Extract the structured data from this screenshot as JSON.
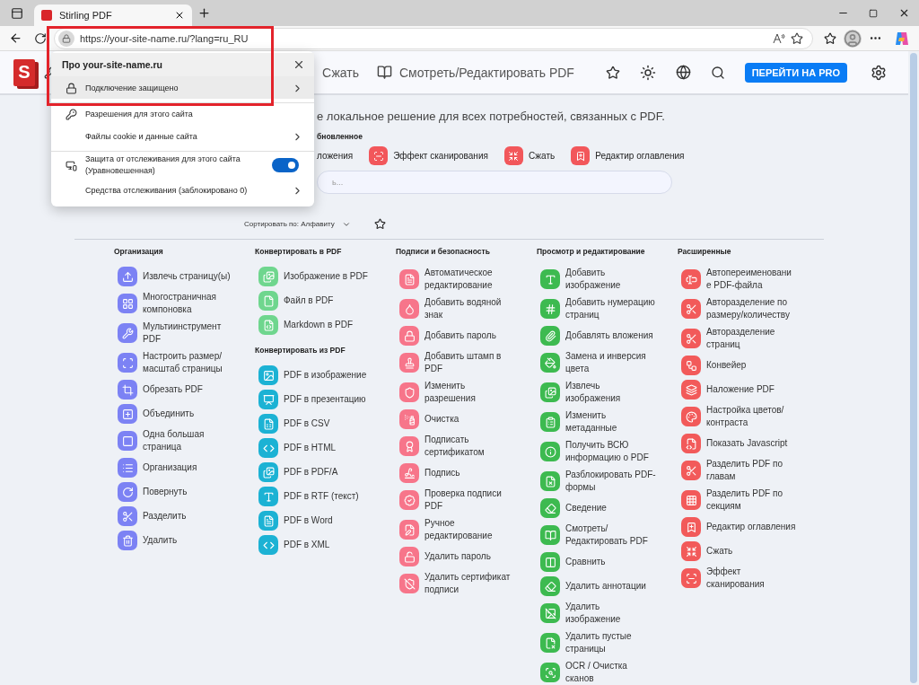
{
  "browser": {
    "tab": {
      "title": "Stirling PDF"
    },
    "address": "https://your-site-name.ru/?lang=ru_RU"
  },
  "site_info_popup": {
    "title": "Про your-site-name.ru",
    "rows": [
      {
        "kind": "link",
        "label": "Подключение защищено",
        "selected": true,
        "divider_before": false
      },
      {
        "kind": "plain",
        "label": "Разрешения для этого сайта",
        "selected": false,
        "divider_before": true
      },
      {
        "kind": "link",
        "label": "Файлы cookie и данные сайта",
        "selected": false,
        "divider_before": false
      },
      {
        "kind": "toggle",
        "label": "Защита от отслеживания для этого сайта (Уравновешенная)",
        "on": true,
        "selected": false,
        "divider_before": true
      },
      {
        "kind": "link",
        "label": "Средства отслеживания (заблокировано 0)",
        "selected": false,
        "divider_before": false
      }
    ]
  },
  "app": {
    "logo": "S",
    "nav": [
      {
        "label": "Сжать"
      },
      {
        "label": "Смотреть/Редактировать PDF"
      }
    ],
    "pro_button": "ПЕРЕЙТИ НА PRO"
  },
  "intro": {
    "tagline": "е локальное решение для всех потребностей, связанных с PDF.",
    "favorites_heading": "бновленное",
    "favorites": [
      {
        "kind": "partial",
        "label": "ложения"
      },
      {
        "kind": "full",
        "label": "Эффект сканирования"
      },
      {
        "kind": "full",
        "label": "Сжать"
      },
      {
        "kind": "full",
        "label": "Редактир оглавления"
      }
    ],
    "search": {
      "placeholder": "ь..."
    }
  },
  "sort": {
    "label": "Сортировать по: Алфавиту"
  },
  "columns": [
    {
      "sections": [
        {
          "title": "Организация",
          "color": "#7c82f4",
          "items": [
            "Извлечь страницу(ы)",
            "Многостраничная компоновка",
            "Мультиинструмент PDF",
            "Настроить размер/ масштаб страницы",
            "Обрезать PDF",
            "Объединить",
            "Одна большая страница",
            "Организация",
            "Повернуть",
            "Разделить",
            "Удалить"
          ]
        }
      ]
    },
    {
      "sections": [
        {
          "title": "Конвертировать в PDF",
          "color": "#6fd68e",
          "items": [
            "Изображение в PDF",
            "Файл в PDF",
            "Markdown в PDF"
          ]
        },
        {
          "title": "Конвертировать из PDF",
          "color": "#1cb2d4",
          "items": [
            "PDF в изображение",
            "PDF в презентацию",
            "PDF в CSV",
            "PDF в HTML",
            "PDF в PDF/A",
            "PDF в RTF (текст)",
            "PDF в Word",
            "PDF в XML"
          ]
        }
      ]
    },
    {
      "sections": [
        {
          "title": "Подписи и безопасность",
          "color": "#f7758a",
          "items": [
            "Автоматическое редактирование",
            "Добавить водяной знак",
            "Добавить пароль",
            "Добавить штамп в PDF",
            "Изменить разрешения",
            "Очистка",
            "Подписать сертификатом",
            "Подпись",
            "Проверка подписи PDF",
            "Ручное редактирование",
            "Удалить пароль",
            "Удалить сертификат подписи"
          ]
        }
      ]
    },
    {
      "sections": [
        {
          "title": "Просмотр и редактирование",
          "color": "#3dba50",
          "items": [
            "Добавить изображение",
            "Добавить нумерацию страниц",
            "Добавлять вложения",
            "Замена и инверсия цвета",
            "Извлечь изображения",
            "Изменить метаданные",
            "Получить ВСЮ информацию о PDF",
            "Разблокировать PDF-формы",
            "Сведение",
            "Смотреть/ Редактировать PDF",
            "Сравнить",
            "Удалить аннотации",
            "Удалить изображение",
            "Удалить пустые страницы",
            "OCR / Очистка сканов"
          ]
        }
      ]
    },
    {
      "sections": [
        {
          "title": "Расширенные",
          "color": "#f25a5a",
          "items": [
            "Автопереименовани е PDF-файла",
            "Авторазделение по размеру/количеству",
            "Авторазделение страниц",
            "Конвейер",
            "Наложение PDF",
            "Настройка цветов/ контраста",
            "Показать Javascript",
            "Разделить PDF по главам",
            "Разделить PDF по секциям",
            "Редактир оглавления",
            "Сжать",
            "Эффект сканирования"
          ]
        }
      ]
    }
  ]
}
